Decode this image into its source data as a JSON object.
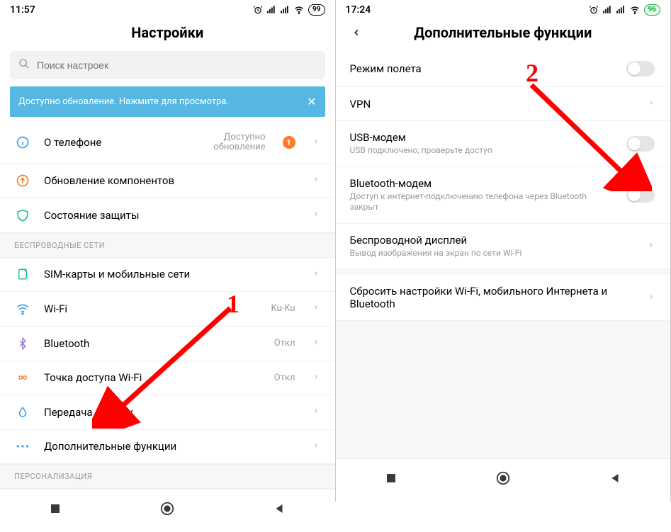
{
  "left": {
    "status": {
      "time": "11:57",
      "battery": "99"
    },
    "header": {
      "title": "Настройки"
    },
    "search": {
      "placeholder": "Поиск настроек"
    },
    "banner": {
      "text": "Доступно обновление. Нажмите для просмотра.",
      "close": "✕"
    },
    "rows": {
      "about": {
        "title": "О телефоне",
        "value": "Доступно\nобновление",
        "badge": "1"
      },
      "update": {
        "title": "Обновление компонентов"
      },
      "security": {
        "title": "Состояние защиты"
      }
    },
    "sections": {
      "wireless": "БЕСПРОВОДНЫЕ СЕТИ",
      "personalization": "ПЕРСОНАЛИЗАЦИЯ"
    },
    "wireless": {
      "sim": {
        "title": "SIM-карты и мобильные сети"
      },
      "wifi": {
        "title": "Wi-Fi",
        "value": "Ku-Ku"
      },
      "bt": {
        "title": "Bluetooth",
        "value": "Откл"
      },
      "hotspot": {
        "title": "Точка доступа Wi-Fi",
        "value": "Откл"
      },
      "datause": {
        "title": "Передача данных"
      },
      "more": {
        "title": "Дополнительные функции"
      }
    }
  },
  "right": {
    "status": {
      "time": "17:24",
      "battery": "96"
    },
    "header": {
      "title": "Дополнительные функции"
    },
    "rows": {
      "airplane": {
        "title": "Режим полета"
      },
      "vpn": {
        "title": "VPN"
      },
      "usb": {
        "title": "USB-модем",
        "sub": "USB подключено, проверьте доступ"
      },
      "btmodem": {
        "title": "Bluetooth-модем",
        "sub": "Доступ к интернет-подключению телефона через Bluetooth закрыт"
      },
      "wdisplay": {
        "title": "Беспроводной дисплей",
        "sub": "Вывод изображения на экран по сети Wi-Fi"
      },
      "reset": {
        "title": "Сбросить настройки Wi-Fi, мобильного Интернета и Bluetooth"
      }
    }
  },
  "annotations": {
    "one": "1",
    "two": "2"
  }
}
